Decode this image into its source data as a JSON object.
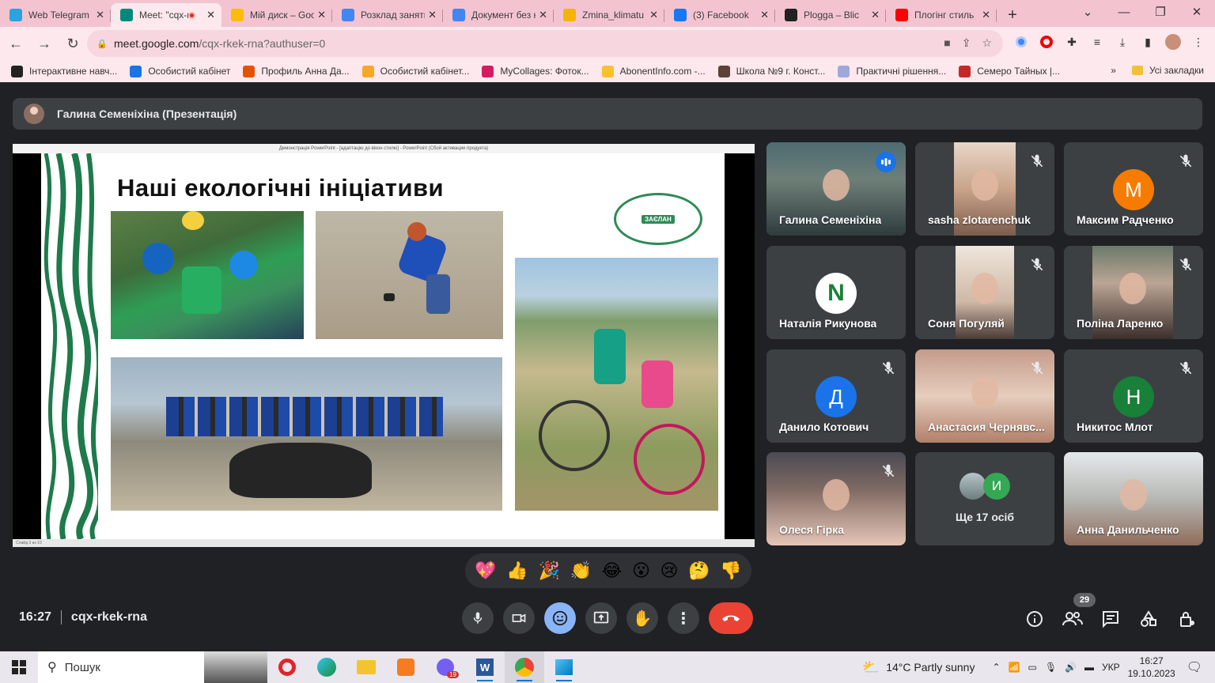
{
  "browser": {
    "tabs": [
      {
        "label": "Web Telegram",
        "icon": "telegram-icon",
        "color": "#2aa3e0",
        "active": false
      },
      {
        "label": "Meet: \"cqx-rkek-rna\"",
        "icon": "meet-icon",
        "color": "#00897b",
        "active": true,
        "recording": true
      },
      {
        "label": "Мій диск – Google Диск",
        "icon": "drive-icon",
        "color": "#fbbc04",
        "active": false
      },
      {
        "label": "Розклад занять",
        "icon": "docs-icon",
        "color": "#4285f4",
        "active": false
      },
      {
        "label": "Документ без назви",
        "icon": "docs-icon",
        "color": "#4285f4",
        "active": false
      },
      {
        "label": "Zmina_klimatu",
        "icon": "slides-icon",
        "color": "#f4b400",
        "active": false
      },
      {
        "label": "(3) Facebook",
        "icon": "facebook-icon",
        "color": "#1877f2",
        "active": false
      },
      {
        "label": "Plogga – Blic",
        "icon": "plogga-icon",
        "color": "#222222",
        "active": false
      },
      {
        "label": "Плогінг стиль",
        "icon": "youtube-icon",
        "color": "#ff0000",
        "active": false
      }
    ],
    "url_host": "meet.google.com",
    "url_path": "/cqx-rkek-rna?authuser=0",
    "bookmarks": [
      {
        "label": "Інтерактивне навч...",
        "color": "#222"
      },
      {
        "label": "Особистий кабінет",
        "color": "#1a73e8"
      },
      {
        "label": "Профиль Анна Да...",
        "color": "#e65100"
      },
      {
        "label": "Особистий кабінет...",
        "color": "#f9a825"
      },
      {
        "label": "MyCollages: Фоток...",
        "color": "#d81b60"
      },
      {
        "label": "AbonentInfo.com -...",
        "color": "#fbc02d"
      },
      {
        "label": "Школа №9 г. Конст...",
        "color": "#5d4037"
      },
      {
        "label": "Практичні рішення...",
        "color": "#9fa8da"
      },
      {
        "label": "Семеро Тайных |...",
        "color": "#c62828"
      }
    ],
    "bookmarks_overflow": "»",
    "all_bookmarks": "Усі закладки"
  },
  "meet": {
    "presenter_label": "Галина Семеніхіна (Презентація)",
    "ppt_titlebar": "Демонстрація PowerPoint - [адаптацію до вікон стилю] - PowerPoint (Сбой активации продукта)",
    "ppt_status": "Слайд 3 из 10",
    "slide_title": "Наші екологічні ініціативи",
    "slide_logo_text": "ЗАЄЛАН",
    "participants": [
      {
        "name": "Галина Семеніхіна",
        "type": "video",
        "speaking": true,
        "muted": false
      },
      {
        "name": "sasha zlotarenchuk",
        "type": "video",
        "speaking": false,
        "muted": true
      },
      {
        "name": "Максим Радченко",
        "type": "letter",
        "letter": "М",
        "color": "#f57c00",
        "muted": true
      },
      {
        "name": "Наталія Рикунова",
        "type": "letter",
        "letter": "N",
        "color": "#ffffff",
        "muted": false
      },
      {
        "name": "Соня Погуляй",
        "type": "video",
        "muted": true
      },
      {
        "name": "Поліна Ларенко",
        "type": "video",
        "muted": true
      },
      {
        "name": "Данило Котович",
        "type": "letter",
        "letter": "Д",
        "color": "#1a73e8",
        "muted": true
      },
      {
        "name": "Анастасия Чернявс...",
        "type": "video",
        "muted": true
      },
      {
        "name": "Никитос Млот",
        "type": "letter",
        "letter": "Н",
        "color": "#188038",
        "muted": true
      },
      {
        "name": "Олеся Гірка",
        "type": "video",
        "muted": true
      },
      {
        "name": "Ще 17 осіб",
        "type": "more",
        "letter": "И",
        "color": "#34a853"
      },
      {
        "name": "Анна Данильченко",
        "type": "video",
        "muted": false
      }
    ],
    "reactions": [
      "💖",
      "👍",
      "🎉",
      "👏",
      "😂",
      "😮",
      "😢",
      "🤔",
      "👎"
    ],
    "time": "16:27",
    "meeting_code": "cqx-rkek-rna",
    "participant_count": "29"
  },
  "taskbar": {
    "search_placeholder": "Пошук",
    "weather": "14°C  Partly sunny",
    "lang": "УКР",
    "time": "16:27",
    "date": "19.10.2023",
    "chat_badge": "19"
  }
}
